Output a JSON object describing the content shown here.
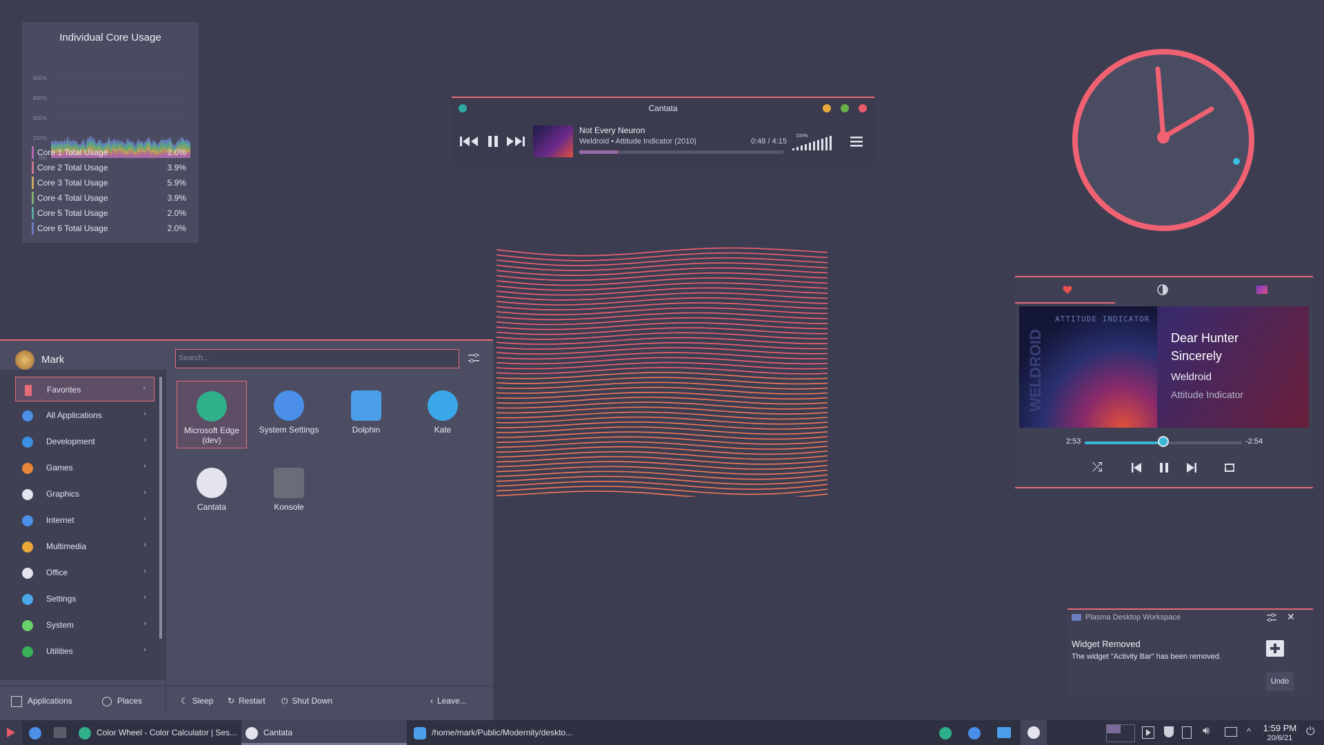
{
  "core_widget": {
    "title": "Individual Core Usage",
    "y_ticks": [
      "600%",
      "450%",
      "300%",
      "150%",
      "0%"
    ],
    "rows": [
      {
        "label": "Core 1 Total Usage",
        "value": "2.0%",
        "color": "#b56bb5"
      },
      {
        "label": "Core 2 Total Usage",
        "value": "3.9%",
        "color": "#c47a8a"
      },
      {
        "label": "Core 3 Total Usage",
        "value": "5.9%",
        "color": "#c9a860"
      },
      {
        "label": "Core 4 Total Usage",
        "value": "3.9%",
        "color": "#7fb06c"
      },
      {
        "label": "Core 5 Total Usage",
        "value": "2.0%",
        "color": "#5aa8a0"
      },
      {
        "label": "Core 6 Total Usage",
        "value": "2.0%",
        "color": "#6a7ec0"
      }
    ]
  },
  "cantata": {
    "title": "Cantata",
    "track": "Not Every Neuron",
    "subtitle": "Weldroid • Attitude Indicator (2010)",
    "time": "0:48 / 4:15",
    "volume": "100%",
    "progress": 0.19
  },
  "launcher": {
    "user": "Mark",
    "search_placeholder": "Search...",
    "categories": [
      {
        "label": "Favorites",
        "color": "#e86b7a"
      },
      {
        "label": "All Applications",
        "color": "#4b8fe8"
      },
      {
        "label": "Development",
        "color": "#3d8fe0"
      },
      {
        "label": "Games",
        "color": "#e8863a"
      },
      {
        "label": "Graphics",
        "color": "#e4e4ee"
      },
      {
        "label": "Internet",
        "color": "#4b8fe8"
      },
      {
        "label": "Multimedia",
        "color": "#e8a83a"
      },
      {
        "label": "Office",
        "color": "#e4e4ee"
      },
      {
        "label": "Settings",
        "color": "#4ba8e8"
      },
      {
        "label": "System",
        "color": "#6ad06a"
      },
      {
        "label": "Utilities",
        "color": "#3ab05a"
      }
    ],
    "apps": [
      {
        "label": "Microsoft Edge (dev)",
        "color": "#2fb08a"
      },
      {
        "label": "System Settings",
        "color": "#4b8fe8"
      },
      {
        "label": "Dolphin",
        "color": "#4b9fe8"
      },
      {
        "label": "Kate",
        "color": "#3aa8e8"
      },
      {
        "label": "Cantata",
        "color": "#e4e4ee"
      },
      {
        "label": "Konsole",
        "color": "#6a6c78"
      }
    ],
    "footer": {
      "applications": "Applications",
      "places": "Places",
      "sleep": "Sleep",
      "restart": "Restart",
      "shutdown": "Shut Down",
      "leave": "Leave..."
    }
  },
  "media_player": {
    "album_art_text_1": "ATTITUDE INDICATOR",
    "album_art_text_2": "WELDROID",
    "title_line1": "Dear Hunter",
    "title_line2": "Sincerely",
    "artist": "Weldroid",
    "album": "Attitude Indicator",
    "elapsed": "2:53",
    "remaining": "-2:54",
    "progress": 0.5
  },
  "notification": {
    "app": "Plasma Desktop Workspace",
    "title": "Widget Removed",
    "body": "The widget \"Activity Bar\" has been removed.",
    "undo": "Undo"
  },
  "taskbar": {
    "task1": "Color Wheel - Color Calculator | Ses...",
    "task2": "Cantata",
    "task3": "/home/mark/Public/Modernity/deskto...",
    "time": "1:59 PM",
    "date": "20/6/21"
  },
  "colors": {
    "accent": "#e86b7a",
    "bg": "#3d3d51"
  }
}
